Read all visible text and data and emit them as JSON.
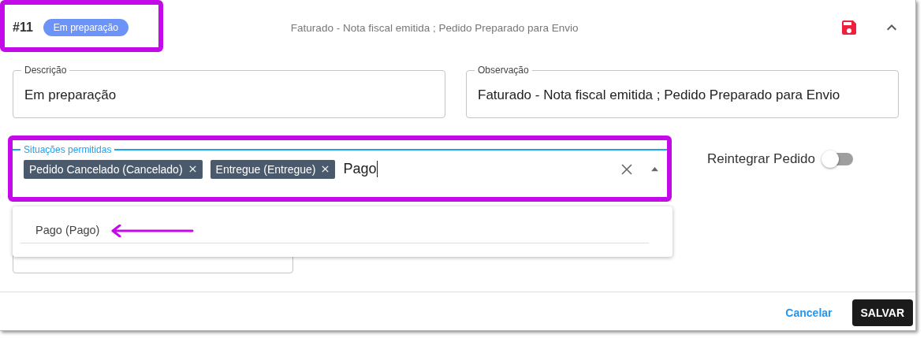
{
  "header": {
    "number": "#11",
    "status_badge": "Em preparação",
    "summary": "Faturado - Nota fiscal emitida ; Pedido Preparado para Envio",
    "expanded": true
  },
  "fields": [
    {
      "label": "Descrição",
      "value": "Em preparação"
    },
    {
      "label": "Observação",
      "value": "Faturado - Nota fiscal emitida ; Pedido Preparado para Envio"
    }
  ],
  "allowed_statuses": {
    "label": "Situações permitidas",
    "chips": [
      "Pedido Cancelado (Cancelado)",
      "Entregue (Entregue)"
    ],
    "value": "Pago",
    "expanded": true,
    "options": [
      "Pago (Pago)"
    ]
  },
  "toggle": {
    "label": "Reintegrar Pedido",
    "on": false
  },
  "buttons": [
    {
      "label": "Cancelar",
      "kind": "text"
    },
    {
      "label": "SALVAR",
      "kind": "primary"
    }
  ]
}
